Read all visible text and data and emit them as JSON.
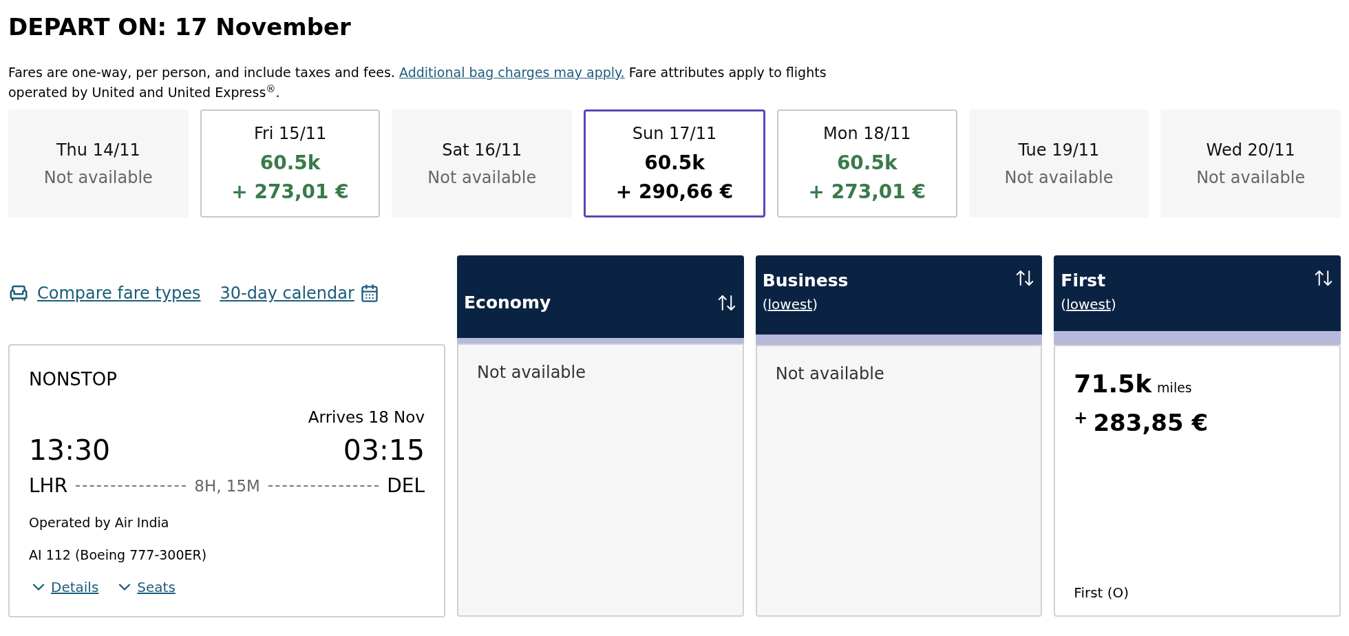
{
  "heading": "DEPART ON: 17 November",
  "notice": {
    "before": "Fares are one-way, per person, and include taxes and fees.",
    "link": "Additional bag charges may apply.",
    "after": "Fare attributes apply to flights operated by United and United Express$^{®}$."
  },
  "dates": [
    {
      "label": "Thu 14/11",
      "kind": "unavailable",
      "status": "Not available",
      "selected": false
    },
    {
      "label": "Fri 15/11",
      "kind": "fare",
      "miles": "60.5k",
      "price": "+ 273,01 €",
      "selected": false
    },
    {
      "label": "Sat 16/11",
      "kind": "unavailable",
      "status": "Not available",
      "selected": false
    },
    {
      "label": "Sun 17/11",
      "kind": "fare",
      "miles": "60.5k",
      "price": "+ 290,66 €",
      "selected": true
    },
    {
      "label": "Mon 18/11",
      "kind": "fare",
      "miles": "60.5k",
      "price": "+ 273,01 €",
      "selected": false
    },
    {
      "label": "Tue 19/11",
      "kind": "unavailable",
      "status": "Not available",
      "selected": false
    },
    {
      "label": "Wed 20/11",
      "kind": "unavailable",
      "status": "Not available",
      "selected": false
    }
  ],
  "links": {
    "compare": "Compare fare types",
    "calendar": "30-day calendar"
  },
  "flight": {
    "stops": "NONSTOP",
    "arrives": "Arrives 18 Nov",
    "depart_time": "13:30",
    "arrive_time": "03:15",
    "origin": "LHR",
    "duration": "8H, 15M",
    "destination": "DEL",
    "operator": "Operated by Air India",
    "flight_number": "AI 112 (Boeing 777-300ER)",
    "actions": [
      "Details",
      "Seats"
    ]
  },
  "cabins": [
    {
      "name": "Economy",
      "kind": "unavailable",
      "status": "Not available"
    },
    {
      "name": "Business",
      "lowest": {
        "open": "(",
        "link": "lowest",
        "close": ")"
      },
      "kind": "unavailable",
      "status": "Not available"
    },
    {
      "name": "First",
      "lowest": {
        "open": "(",
        "link": "lowest",
        "close": ")"
      },
      "kind": "fare",
      "miles": "71.5k",
      "miles_unit": "miles",
      "plus": "+",
      "price": "283,85 €",
      "fare_class": "First (O)"
    }
  ]
}
